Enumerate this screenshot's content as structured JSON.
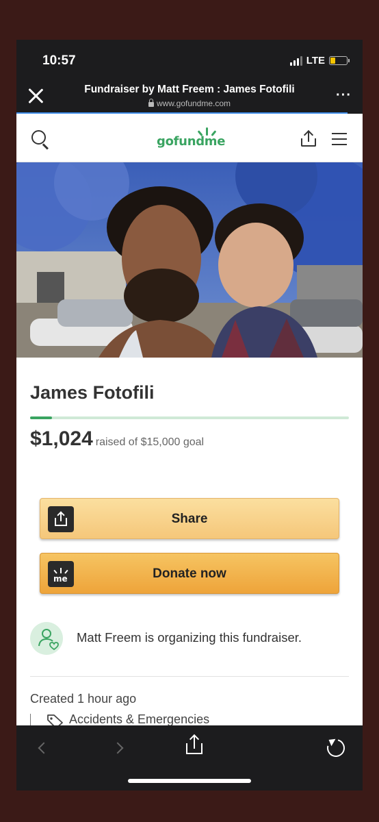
{
  "status_bar": {
    "time": "10:57",
    "network": "LTE",
    "battery_level": 0.3
  },
  "browser": {
    "title": "Fundraiser by Matt Freem : James Fotofili",
    "url": "www.gofundme.com",
    "close_icon": "close-icon",
    "more_icon": "more-icon"
  },
  "site_header": {
    "logo_text": "gofundme",
    "search_icon": "search-icon",
    "share_icon": "share-icon",
    "menu_icon": "menu-icon"
  },
  "campaign": {
    "title": "James Fotofili",
    "raised": "$1,024",
    "goal_text": "raised of $15,000 goal",
    "progress_fraction": 0.068,
    "share_label": "Share",
    "donate_label": "Donate now",
    "organizer_text": "Matt Freem is organizing this fundraiser.",
    "created": "Created 1 hour ago",
    "category": "Accidents & Emergencies"
  },
  "colors": {
    "brand_green": "#3aa461",
    "share_button": "#f5c77a",
    "donate_button": "#eea43a"
  },
  "toolbar": {
    "back_icon": "chevron-left-icon",
    "forward_icon": "chevron-right-icon",
    "share_icon": "share-icon",
    "reload_icon": "reload-icon"
  }
}
